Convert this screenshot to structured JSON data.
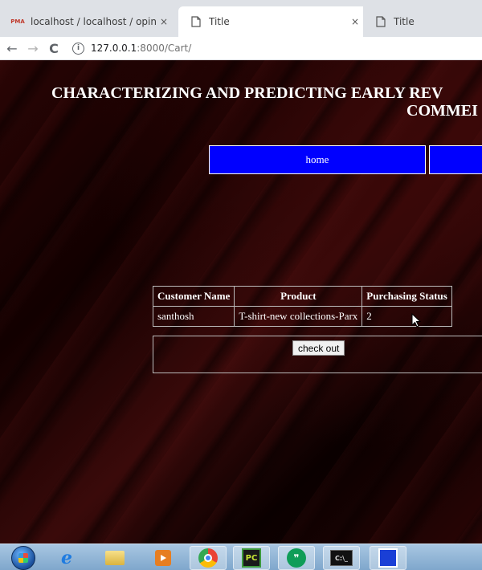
{
  "browser": {
    "tabs": [
      {
        "title": "localhost / localhost / opinionmi",
        "icon": "phpmyadmin-icon",
        "icon_text": "PMA",
        "close": "×"
      },
      {
        "title": "Title",
        "icon": "document-icon",
        "close": "×"
      },
      {
        "title": "Title",
        "icon": "document-icon"
      }
    ],
    "nav": {
      "back": "←",
      "forward": "→",
      "reload": "C"
    },
    "address": {
      "info": "i",
      "host": "127.0.0.1",
      "path": ":8000/Cart/"
    }
  },
  "page": {
    "title_line1": "CHARACTERIZING AND PREDICTING EARLY REV",
    "title_line2": "COMMEI",
    "nav": {
      "home": "home",
      "next": ""
    },
    "table": {
      "headers": [
        "Customer Name",
        "Product",
        "Purchasing Status"
      ],
      "rows": [
        [
          "santhosh",
          "T-shirt-new collections-Parx",
          "2"
        ]
      ]
    },
    "checkout_label": "check out"
  },
  "taskbar": {
    "items": [
      "start-orb",
      "internet-explorer-icon",
      "file-explorer-icon",
      "media-player-icon",
      "chrome-icon",
      "pycharm-icon",
      "hangouts-icon",
      "command-prompt-icon",
      "app-icon"
    ],
    "pycharm_label": "PC",
    "hangouts_label": "❞",
    "cmd_label": "C:\\_"
  },
  "colors": {
    "nav_blue": "#0000ff",
    "page_bg": "#1a0202"
  }
}
